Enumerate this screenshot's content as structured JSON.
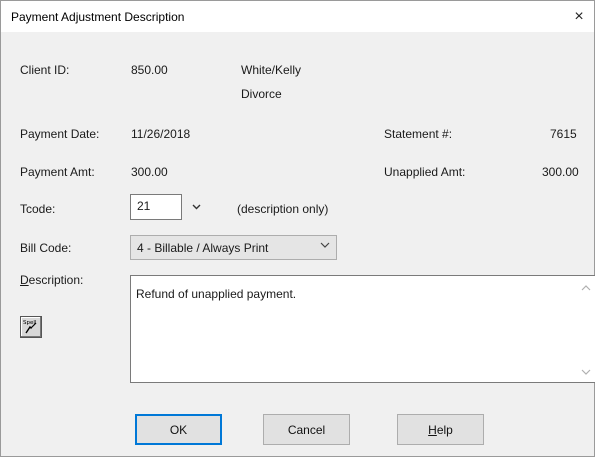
{
  "window": {
    "title": "Payment Adjustment Description",
    "close_glyph": "×"
  },
  "client": {
    "label": "Client ID:",
    "id": "850.00",
    "name": "White/Kelly",
    "matter": "Divorce"
  },
  "payment_date": {
    "label": "Payment Date:",
    "value": "11/26/2018"
  },
  "statement": {
    "label": "Statement #:",
    "value": "7615"
  },
  "payment_amt": {
    "label": "Payment Amt:",
    "value": "300.00"
  },
  "unapplied_amt": {
    "label": "Unapplied Amt:",
    "value": "300.00"
  },
  "tcode": {
    "label": "Tcode:",
    "value": "21",
    "note": "(description only)"
  },
  "bill_code": {
    "label": "Bill Code:",
    "selected": "4 - Billable / Always Print"
  },
  "description": {
    "label_rest": "escription:",
    "label_accel": "D",
    "text": "Refund of unapplied payment."
  },
  "spell": {
    "label": "Spell"
  },
  "buttons": {
    "ok": "OK",
    "cancel": "Cancel",
    "help_accel": "H",
    "help_rest": "elp"
  },
  "icons": {
    "close": "close-icon",
    "tcode_dropdown": "chevron-down-icon",
    "bill_dropdown": "chevron-down-icon",
    "spell": "spell-check-icon"
  }
}
